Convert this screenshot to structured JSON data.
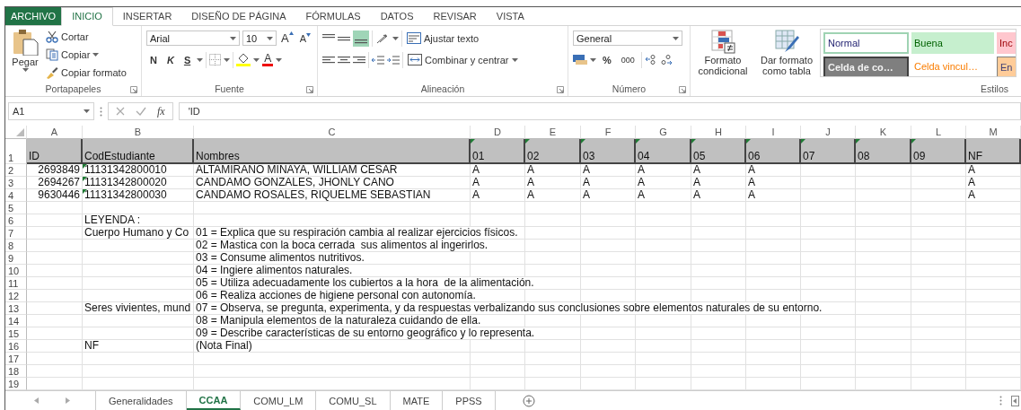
{
  "ribbon_tabs": [
    {
      "label": "ARCHIVO",
      "kind": "file",
      "selected": false
    },
    {
      "label": "INICIO",
      "kind": "tab",
      "selected": true
    },
    {
      "label": "INSERTAR",
      "kind": "tab",
      "selected": false
    },
    {
      "label": "DISEÑO DE PÁGINA",
      "kind": "tab",
      "selected": false
    },
    {
      "label": "FÓRMULAS",
      "kind": "tab",
      "selected": false
    },
    {
      "label": "DATOS",
      "kind": "tab",
      "selected": false
    },
    {
      "label": "REVISAR",
      "kind": "tab",
      "selected": false
    },
    {
      "label": "VISTA",
      "kind": "tab",
      "selected": false
    }
  ],
  "clipboard": {
    "paste": "Pegar",
    "cut": "Cortar",
    "copy": "Copiar",
    "format_painter": "Copiar formato",
    "group_label": "Portapapeles"
  },
  "font": {
    "name": "Arial",
    "size": "10",
    "grow": "A",
    "shrink": "A",
    "bold": "N",
    "italic": "K",
    "underline": "S",
    "font_color": "A",
    "group_label": "Fuente"
  },
  "alignment": {
    "wrap_text": "Ajustar texto",
    "merge_center": "Combinar y centrar",
    "group_label": "Alineación"
  },
  "number": {
    "format": "General",
    "percent": "%",
    "thousands": "000",
    "group_label": "Número"
  },
  "styles": {
    "conditional_format": "Formato condicional",
    "format_as_table": "Dar formato como tabla",
    "group_label": "Estilos",
    "gallery": [
      {
        "label": "Normal",
        "kind": "normal"
      },
      {
        "label": "Buena",
        "kind": "good"
      },
      {
        "label": "Inc",
        "kind": "bad"
      },
      {
        "label": "Celda de co…",
        "kind": "check"
      },
      {
        "label": "Celda vincul…",
        "kind": "linked"
      },
      {
        "label": "En",
        "kind": "input"
      }
    ]
  },
  "formula_bar": {
    "name_box": "A1",
    "function_label": "fx",
    "formula": "'ID"
  },
  "sheet": {
    "columns": [
      "A",
      "B",
      "C",
      "D",
      "E",
      "F",
      "G",
      "H",
      "I",
      "J",
      "K",
      "L",
      "M"
    ],
    "rows": [
      {
        "number": "1",
        "kind": "header",
        "cells": {
          "A": {
            "text": "ID",
            "kind": "text",
            "flagged": false
          },
          "B": {
            "text": "CodEstudiante",
            "kind": "text",
            "flagged": false
          },
          "C": {
            "text": "Nombres",
            "kind": "text",
            "flagged": false
          },
          "D": {
            "text": "01",
            "kind": "text",
            "flagged": true
          },
          "E": {
            "text": "02",
            "kind": "text",
            "flagged": true
          },
          "F": {
            "text": "03",
            "kind": "text",
            "flagged": true
          },
          "G": {
            "text": "04",
            "kind": "text",
            "flagged": true
          },
          "H": {
            "text": "05",
            "kind": "text",
            "flagged": true
          },
          "I": {
            "text": "06",
            "kind": "text",
            "flagged": true
          },
          "J": {
            "text": "07",
            "kind": "text",
            "flagged": true
          },
          "K": {
            "text": "08",
            "kind": "text",
            "flagged": true
          },
          "L": {
            "text": "09",
            "kind": "text",
            "flagged": true
          },
          "M": {
            "text": "NF",
            "kind": "text",
            "flagged": false
          }
        }
      },
      {
        "number": "2",
        "kind": "data",
        "cells": {
          "A": {
            "text": "2693849",
            "kind": "number",
            "flagged": false
          },
          "B": {
            "text": "11131342800010",
            "kind": "text",
            "flagged": true
          },
          "C": {
            "text": "ALTAMIRANO MINAYA, WILLIAM CESAR",
            "kind": "text",
            "flagged": false
          },
          "D": {
            "text": "A",
            "kind": "text",
            "flagged": false
          },
          "E": {
            "text": "A",
            "kind": "text",
            "flagged": false
          },
          "F": {
            "text": "A",
            "kind": "text",
            "flagged": false
          },
          "G": {
            "text": "A",
            "kind": "text",
            "flagged": false
          },
          "H": {
            "text": "A",
            "kind": "text",
            "flagged": false
          },
          "I": {
            "text": "A",
            "kind": "text",
            "flagged": false
          },
          "M": {
            "text": "A",
            "kind": "text",
            "flagged": false
          }
        }
      },
      {
        "number": "3",
        "kind": "data",
        "cells": {
          "A": {
            "text": "2694267",
            "kind": "number",
            "flagged": false
          },
          "B": {
            "text": "11131342800020",
            "kind": "text",
            "flagged": true
          },
          "C": {
            "text": "CANDAMO GONZALES, JHONLY CANO",
            "kind": "text",
            "flagged": false
          },
          "D": {
            "text": "A",
            "kind": "text",
            "flagged": false
          },
          "E": {
            "text": "A",
            "kind": "text",
            "flagged": false
          },
          "F": {
            "text": "A",
            "kind": "text",
            "flagged": false
          },
          "G": {
            "text": "A",
            "kind": "text",
            "flagged": false
          },
          "H": {
            "text": "A",
            "kind": "text",
            "flagged": false
          },
          "I": {
            "text": "A",
            "kind": "text",
            "flagged": false
          },
          "M": {
            "text": "A",
            "kind": "text",
            "flagged": false
          }
        }
      },
      {
        "number": "4",
        "kind": "data",
        "cells": {
          "A": {
            "text": "9630446",
            "kind": "number",
            "flagged": false
          },
          "B": {
            "text": "11131342800030",
            "kind": "text",
            "flagged": true
          },
          "C": {
            "text": "CANDAMO ROSALES, RIQUELME SEBASTIAN",
            "kind": "text",
            "flagged": false
          },
          "D": {
            "text": "A",
            "kind": "text",
            "flagged": false
          },
          "E": {
            "text": "A",
            "kind": "text",
            "flagged": false
          },
          "F": {
            "text": "A",
            "kind": "text",
            "flagged": false
          },
          "G": {
            "text": "A",
            "kind": "text",
            "flagged": false
          },
          "H": {
            "text": "A",
            "kind": "text",
            "flagged": false
          },
          "I": {
            "text": "A",
            "kind": "text",
            "flagged": false
          },
          "M": {
            "text": "A",
            "kind": "text",
            "flagged": false
          }
        }
      },
      {
        "number": "5",
        "kind": "data"
      },
      {
        "number": "6",
        "kind": "data",
        "cells": {
          "B": {
            "text": "LEYENDA :",
            "kind": "text",
            "flagged": false
          }
        }
      },
      {
        "number": "7",
        "kind": "data",
        "cells": {
          "B": {
            "text": "Cuerpo Humano y Co",
            "kind": "text",
            "flagged": false
          },
          "C": {
            "text": "01 = Explica que su respiración cambia al realizar ejercicios físicos.",
            "kind": "text",
            "flagged": false
          }
        }
      },
      {
        "number": "8",
        "kind": "data",
        "cells": {
          "C": {
            "text": "02 = Mastica con la boca cerrada  sus alimentos al ingerirlos.",
            "kind": "text",
            "flagged": false
          }
        }
      },
      {
        "number": "9",
        "kind": "data",
        "cells": {
          "C": {
            "text": "03 = Consume alimentos nutritivos.",
            "kind": "text",
            "flagged": false
          }
        }
      },
      {
        "number": "10",
        "kind": "data",
        "cells": {
          "C": {
            "text": "04 = Ingiere alimentos naturales.",
            "kind": "text",
            "flagged": false
          }
        }
      },
      {
        "number": "11",
        "kind": "data",
        "cells": {
          "C": {
            "text": "05 = Utiliza adecuadamente los cubiertos a la hora  de la alimentación.",
            "kind": "text",
            "flagged": false
          }
        }
      },
      {
        "number": "12",
        "kind": "data",
        "cells": {
          "C": {
            "text": "06 = Realiza acciones de higiene personal con autonomía.",
            "kind": "text",
            "flagged": false
          }
        }
      },
      {
        "number": "13",
        "kind": "data",
        "cells": {
          "B": {
            "text": "Seres vivientes, mund",
            "kind": "text",
            "flagged": false
          },
          "C": {
            "text": "07 = Observa, se pregunta, experimenta, y da respuestas verbalizando sus conclusiones sobre elementos naturales de su entorno.",
            "kind": "text",
            "flagged": false
          }
        }
      },
      {
        "number": "14",
        "kind": "data",
        "cells": {
          "C": {
            "text": "08 = Manipula elementos de la naturaleza cuidando de ella.",
            "kind": "text",
            "flagged": false
          }
        }
      },
      {
        "number": "15",
        "kind": "data",
        "cells": {
          "C": {
            "text": "09 = Describe características de su entorno geográfico y lo representa.",
            "kind": "text",
            "flagged": false
          }
        }
      },
      {
        "number": "16",
        "kind": "data",
        "cells": {
          "B": {
            "text": "NF",
            "kind": "text",
            "flagged": false
          },
          "C": {
            "text": "(Nota Final)",
            "kind": "text",
            "flagged": false
          }
        }
      },
      {
        "number": "17",
        "kind": "data"
      },
      {
        "number": "18",
        "kind": "data"
      },
      {
        "number": "19",
        "kind": "data"
      }
    ]
  },
  "sheet_tabs": [
    {
      "label": "Generalidades",
      "selected": false
    },
    {
      "label": "CCAA",
      "selected": true
    },
    {
      "label": "COMU_LM",
      "selected": false
    },
    {
      "label": "COMU_SL",
      "selected": false
    },
    {
      "label": "MATE",
      "selected": false
    },
    {
      "label": "PPSS",
      "selected": false
    }
  ]
}
